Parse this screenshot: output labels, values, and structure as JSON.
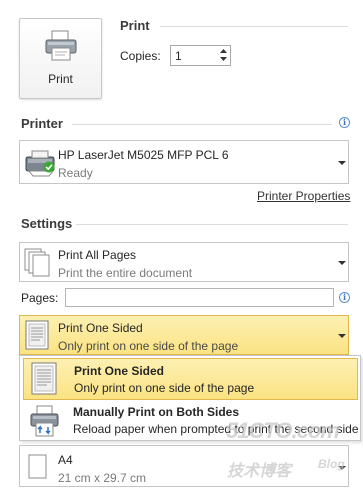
{
  "print_button": {
    "label": "Print"
  },
  "print_section": {
    "title": "Print",
    "copies_label": "Copies:",
    "copies_value": "1"
  },
  "printer": {
    "title": "Printer",
    "name": "HP LaserJet M5025 MFP PCL 6",
    "status": "Ready",
    "properties_link": "Printer Properties"
  },
  "settings": {
    "title": "Settings",
    "pages_dropdown": {
      "label": "Print All Pages",
      "sub": "Print the entire document"
    },
    "pages_label": "Pages:",
    "pages_value": "",
    "sides_dropdown": {
      "label": "Print One Sided",
      "sub": "Only print on one side of the page"
    },
    "sides_menu": [
      {
        "label": "Print One Sided",
        "sub": "Only print on one side of the page",
        "selected": true
      },
      {
        "label": "Manually Print on Both Sides",
        "sub": "Reload paper when prompted to print the second side",
        "selected": false
      }
    ],
    "paper_dropdown": {
      "label": "A4",
      "sub": "21 cm x 29.7 cm"
    }
  },
  "watermark": {
    "line1": "51CTO.com",
    "line2": "技术博客",
    "line3": "Blog"
  },
  "colors": {
    "highlight": "#fbe383",
    "highlight_border": "#e0b84f",
    "link": "#333333",
    "info": "#3a74c4"
  }
}
